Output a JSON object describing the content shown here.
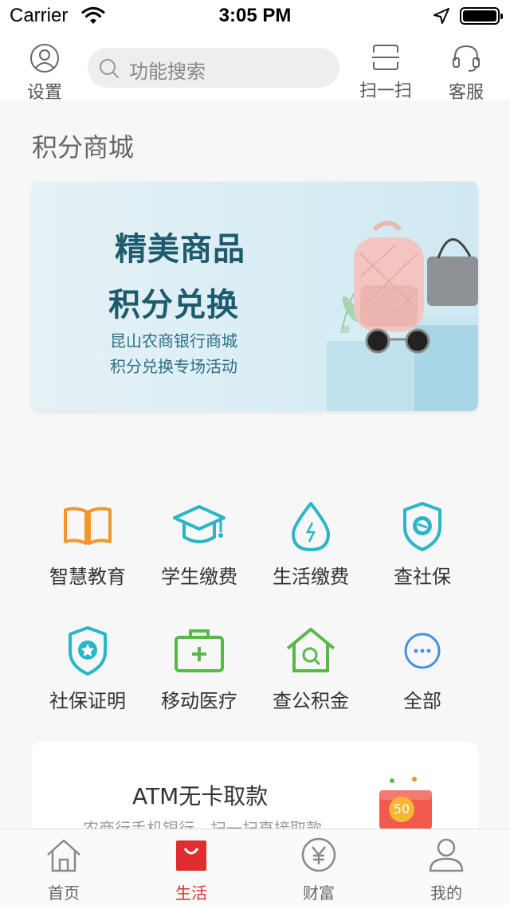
{
  "status_bar": {
    "carrier": "Carrier",
    "time": "3:05 PM"
  },
  "topbar": {
    "settings_label": "设置",
    "search_placeholder": "功能搜索",
    "scan_label": "扫一扫",
    "service_label": "客服"
  },
  "section": {
    "title": "积分商城"
  },
  "banner": {
    "headline1": "精美商品",
    "headline2": "积分兑换",
    "sub1": "昆山农商银行商城",
    "sub2": "积分兑换专场活动"
  },
  "services": [
    {
      "label": "智慧教育",
      "icon": "book-icon",
      "color": "#f0962e"
    },
    {
      "label": "学生缴费",
      "icon": "graduation-cap-icon",
      "color": "#29b6c6"
    },
    {
      "label": "生活缴费",
      "icon": "water-drop-icon",
      "color": "#29b6c6"
    },
    {
      "label": "查社保",
      "icon": "social-security-shield-icon",
      "color": "#29b6c6"
    },
    {
      "label": "社保证明",
      "icon": "shield-star-icon",
      "color": "#29b6c6"
    },
    {
      "label": "移动医疗",
      "icon": "medical-kit-icon",
      "color": "#5ab848"
    },
    {
      "label": "查公积金",
      "icon": "house-search-icon",
      "color": "#5ab848"
    },
    {
      "label": "全部",
      "icon": "more-icon",
      "color": "#4a90e2"
    }
  ],
  "atm_card": {
    "title": "ATM无卡取款",
    "subtitle": "农商行手机银行，扫一扫直接取款",
    "badge": "50"
  },
  "tabbar": {
    "items": [
      {
        "label": "首页",
        "icon": "home-icon"
      },
      {
        "label": "生活",
        "icon": "shopping-bag-icon",
        "active": true
      },
      {
        "label": "财富",
        "icon": "yen-coin-icon"
      },
      {
        "label": "我的",
        "icon": "user-icon"
      }
    ],
    "active_color": "#e02e2e"
  }
}
